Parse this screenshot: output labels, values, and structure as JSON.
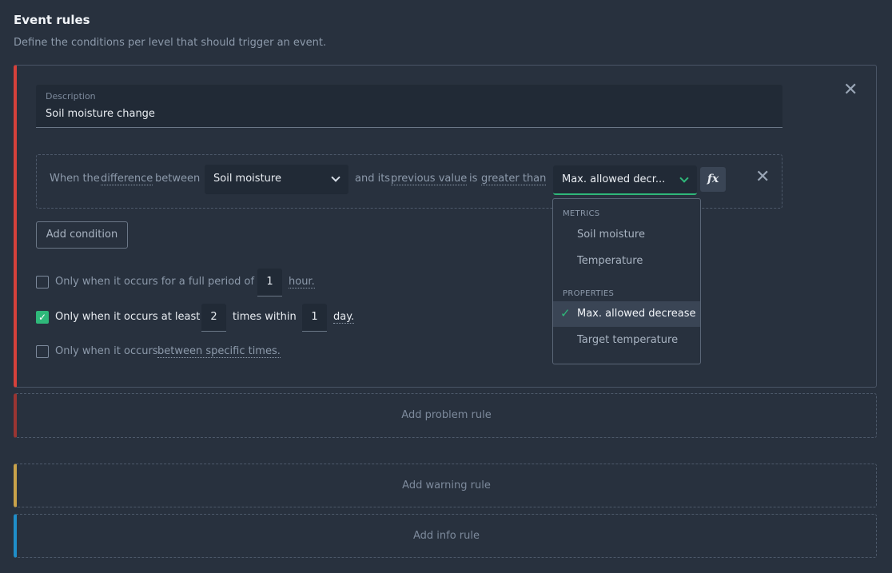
{
  "header": {
    "title": "Event rules",
    "subtitle": "Define the conditions per level that should trigger an event."
  },
  "rule": {
    "accent": "#d6413b",
    "description_label": "Description",
    "description_value": "Soil moisture change",
    "condition": {
      "prefix": "When the",
      "difference_link": "difference",
      "between": "between",
      "metric_selected": "Soil moisture",
      "and_its": "and its",
      "previous_value_link": "previous value",
      "is": "is",
      "comparator_link": "greater than",
      "threshold_selected": "Max. allowed decr...",
      "fx_label": "fx"
    },
    "add_condition_label": "Add condition",
    "options": [
      {
        "checked": false,
        "text_before": "Only when it occurs for a full period of",
        "value1": "1",
        "unit1": "hour."
      },
      {
        "checked": true,
        "text_before": "Only when it occurs at least",
        "value1": "2",
        "middle": "times within",
        "value2": "1",
        "unit2": "day."
      },
      {
        "checked": false,
        "text_before": "Only when it occurs",
        "link": "between specific times."
      }
    ]
  },
  "dropdown": {
    "groups": [
      {
        "heading": "METRICS",
        "items": [
          "Soil moisture",
          "Temperature"
        ]
      },
      {
        "heading": "PROPERTIES",
        "items": [
          "Max. allowed decrease",
          "Target temperature"
        ]
      }
    ],
    "selected": "Max. allowed decrease"
  },
  "add_rules": [
    {
      "label": "Add problem rule",
      "accent": "#9a3532"
    },
    {
      "label": "Add warning rule",
      "accent": "#c9a24a"
    },
    {
      "label": "Add info rule",
      "accent": "#1f8ec9"
    }
  ],
  "colors": {
    "background": "#28313e",
    "success": "#2fb87a"
  }
}
